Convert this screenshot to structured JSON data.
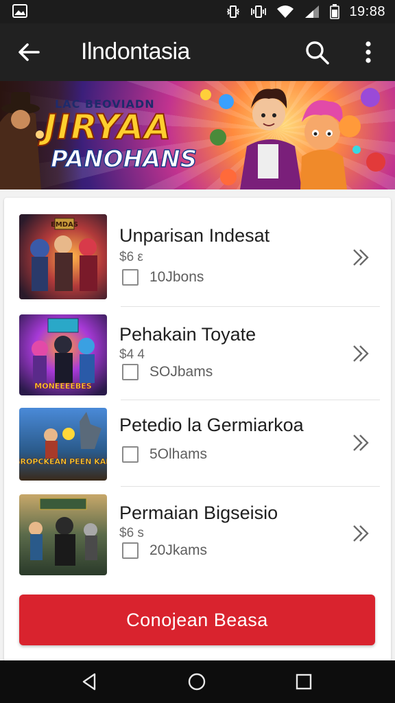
{
  "status_bar": {
    "time": "19:88",
    "icons": [
      "gallery-icon",
      "vibrate-icon",
      "vibrate-icon",
      "wifi-icon",
      "signal-icon",
      "battery-icon"
    ]
  },
  "app_bar": {
    "title": "Ilndontasia",
    "icons": [
      "back-arrow-icon",
      "search-icon",
      "more-vert-icon"
    ]
  },
  "banner": {
    "small_text": "LAC BEOVIADN",
    "big_text_1": "JIRYAA",
    "big_text_2": "PANOHANS"
  },
  "items": [
    {
      "title": "Unparisan Indesat",
      "price": "$6 ε",
      "count": "10Jbons",
      "thumb_text": "EMDAS"
    },
    {
      "title": "Pehakain Toyate",
      "price": "$4 4",
      "count": "SOJbams",
      "thumb_text": "MONEEEEBES"
    },
    {
      "title": "Petedio la Germiarkoa",
      "price": "",
      "count": "5Olhams",
      "thumb_text": "GROPCKEAN PEEN KAN"
    },
    {
      "title": "Permaian Bigseisio",
      "price": "$6 s",
      "count": "20Jkams",
      "thumb_text": ""
    }
  ],
  "cta": {
    "label": "Conojean Beasa"
  },
  "nav_bar": {
    "icons": [
      "back-triangle-icon",
      "home-circle-icon",
      "recents-square-icon"
    ]
  },
  "colors": {
    "accent": "#d9232e",
    "app_bar": "#212121",
    "status_bar": "#1c1c1c",
    "nav_bar": "#0d0d0d"
  }
}
